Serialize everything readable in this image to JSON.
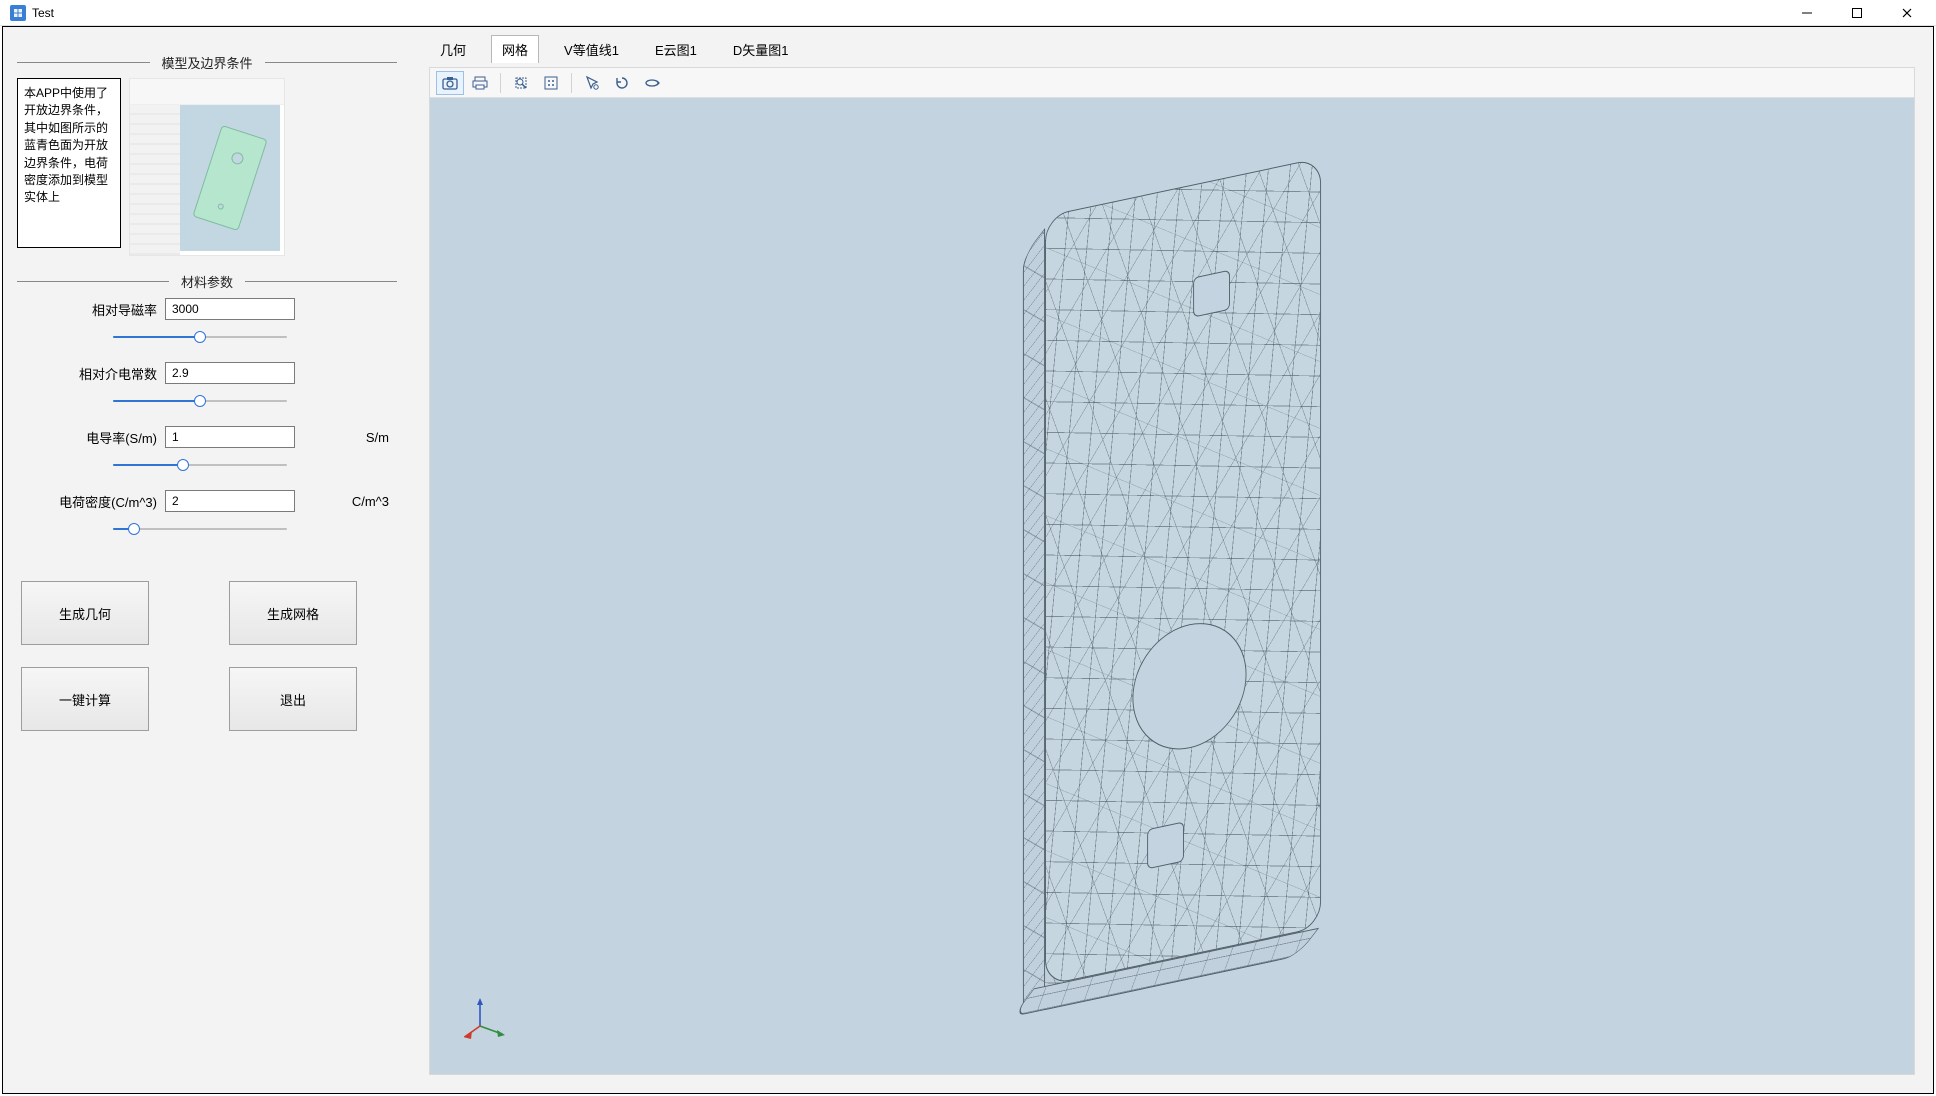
{
  "window": {
    "title": "Test"
  },
  "sidebar": {
    "group_model_title": "模型及边界条件",
    "description": "本APP中使用了开放边界条件，其中如图所示的蓝青色面为开放边界条件，电荷密度添加到模型实体上",
    "group_material_title": "材料参数",
    "params": {
      "rel_perm_label": "相对导磁率",
      "rel_perm_value": "3000",
      "rel_perm_slider_pct": 50,
      "rel_eps_label": "相对介电常数",
      "rel_eps_value": "2.9",
      "rel_eps_slider_pct": 50,
      "conductivity_label": "电导率(S/m)",
      "conductivity_value": "1",
      "conductivity_unit": "S/m",
      "conductivity_slider_pct": 40,
      "charge_label": "电荷密度(C/m^3)",
      "charge_value": "2",
      "charge_unit": "C/m^3",
      "charge_slider_pct": 12
    },
    "buttons": {
      "gen_geom": "生成几何",
      "gen_mesh": "生成网格",
      "compute": "一键计算",
      "exit": "退出"
    }
  },
  "tabs": {
    "items": [
      {
        "id": "geom",
        "label": "几何"
      },
      {
        "id": "mesh",
        "label": "网格"
      },
      {
        "id": "viso",
        "label": "V等值线1"
      },
      {
        "id": "ecloud",
        "label": "E云图1"
      },
      {
        "id": "dvector",
        "label": "D矢量图1"
      }
    ],
    "active": "mesh"
  },
  "toolbar": {
    "items": [
      {
        "id": "screenshot",
        "name": "screenshot-icon",
        "active": true
      },
      {
        "id": "print",
        "name": "print-icon",
        "active": false
      },
      {
        "sep": true
      },
      {
        "id": "zoom-extents",
        "name": "zoom-extents-icon",
        "active": false
      },
      {
        "id": "zoom-box",
        "name": "zoom-box-icon",
        "active": false
      },
      {
        "sep": true
      },
      {
        "id": "select",
        "name": "select-arrow-icon",
        "active": false
      },
      {
        "id": "reset-view",
        "name": "reset-view-icon",
        "active": false
      },
      {
        "id": "rotate",
        "name": "rotate-icon",
        "active": false
      }
    ]
  },
  "axis": {
    "x_color": "#d03a2b",
    "y_color": "#2f8f3c",
    "z_color": "#3156c1"
  }
}
